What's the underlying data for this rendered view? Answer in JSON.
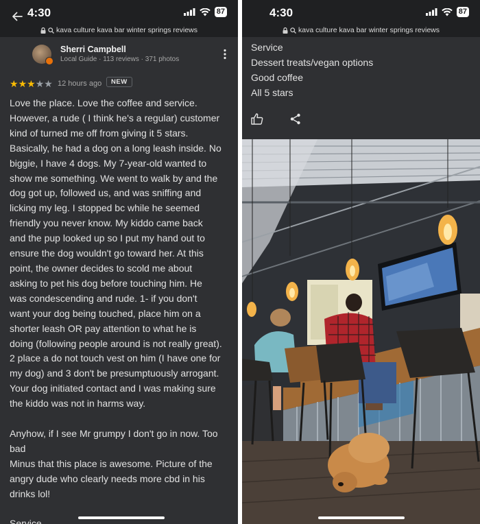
{
  "left": {
    "status": {
      "time": "4:30",
      "battery": "87"
    },
    "url": "kava culture kava bar winter springs reviews",
    "reviewer": {
      "name": "Sherri Campbell",
      "meta": "Local Guide · 113 reviews · 371 photos"
    },
    "rating": {
      "value": 3,
      "max": 5
    },
    "time_ago": "12 hours ago",
    "badge": "NEW",
    "review_lines": [
      "Love the place. Love the coffee and service.",
      "However, a rude ( I think he's a regular) customer",
      "kind of turned me off from giving it 5 stars.",
      "Basically, he had a dog on a long leash inside. No",
      "biggie, I have 4 dogs. My 7-year-old wanted to",
      "show me something. We went to walk by and the",
      "dog got up, followed us, and was sniffing and",
      "licking my leg. I stopped bc while he seemed",
      "friendly you never know. My kiddo came back",
      "and the pup looked up so I put my hand out to",
      "ensure the dog wouldn't go toward her. At this",
      "point, the owner decides to scold me about",
      "asking to pet his dog before touching him. He",
      "was condescending and rude. 1- if you don't",
      "want your dog being touched, place him on a",
      "shorter leash OR pay attention to what he is",
      "doing (following people around is not really great).",
      "2 place a do not touch vest on him (I have one for",
      "my dog) and 3 don't be presumptuously arrogant.",
      "Your dog initiated contact and I was making sure",
      "the kiddo was not in harms way.",
      "",
      "Anyhow, if I see Mr grumpy I don't go in now. Too",
      "bad",
      "Minus that this place is awesome. Picture of the",
      "angry dude who clearly needs more cbd in his",
      "drinks lol!",
      "",
      "Service"
    ]
  },
  "right": {
    "status": {
      "time": "4:30",
      "battery": "87"
    },
    "url": "kava culture kava bar winter springs reviews",
    "list_items": [
      "Service",
      "Dessert treats/vegan options",
      "Good coffee",
      "All 5 stars"
    ]
  },
  "colors": {
    "panel_bg": "#2f3033",
    "status_bg": "#1f2022",
    "star_filled": "#fbbc04",
    "star_empty": "#9aa0a6"
  }
}
